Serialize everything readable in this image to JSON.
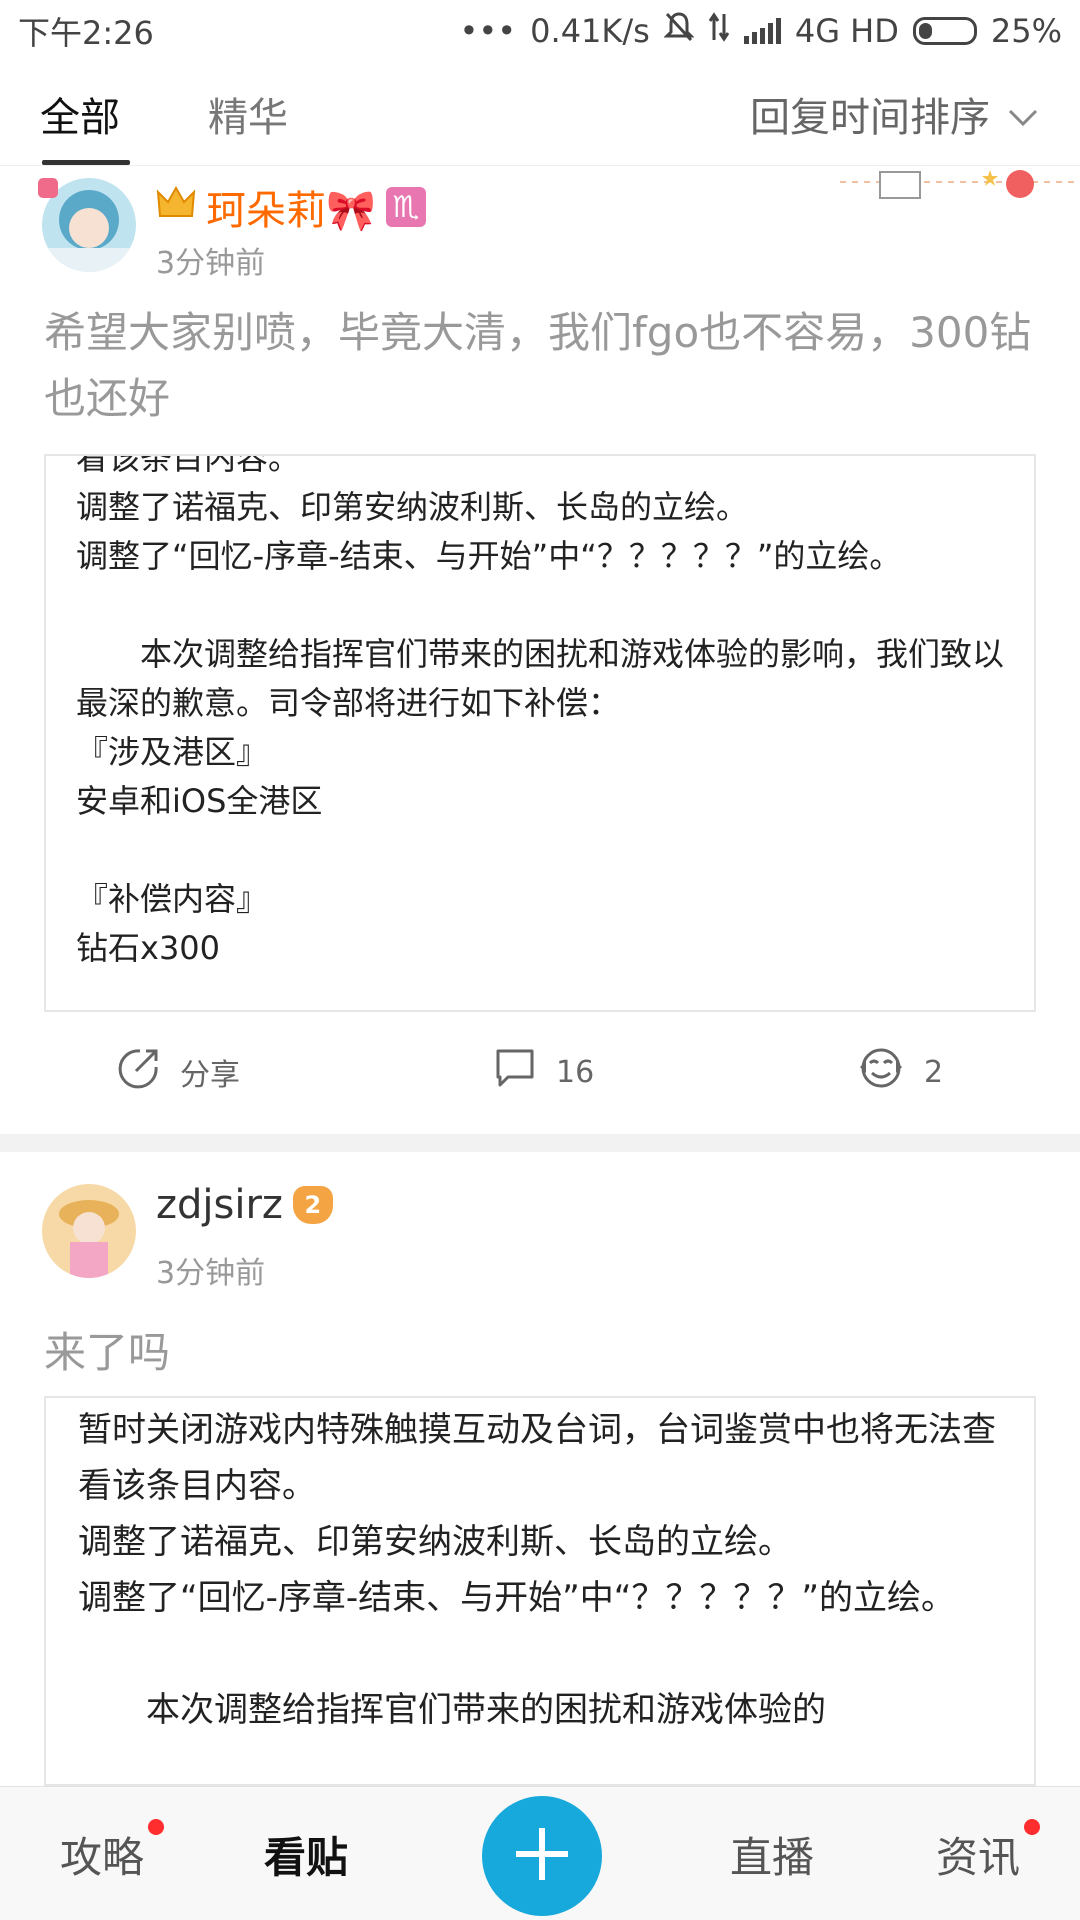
{
  "status_bar": {
    "time": "下午2:26",
    "network_speed": "0.41K/s",
    "network_type": "4G HD",
    "battery": "25%",
    "battery_level": 0.25
  },
  "tabs": {
    "all": "全部",
    "featured": "精华",
    "sort_label": "回复时间排序"
  },
  "posts": [
    {
      "user": "珂朵莉🎀",
      "zodiac": "♏",
      "time": "3分钟前",
      "text": "希望大家别喷，毕竟大清，我们fgo也不容易，300钻也还好",
      "quote": "看该条目内容。\n调整了诺福克、印第安纳波利斯、长岛的立绘。\n调整了“回忆-序章-结束、与开始”中“？？？？？”的立绘。\n\n　　本次调整给指挥官们带来的困扰和游戏体验的影响，我们致以最深的歉意。司令部将进行如下补偿：\n『涉及港区』\n安卓和iOS全港区\n\n『补偿内容』\n钻石x300",
      "share_label": "分享",
      "comment_count": "16",
      "like_count": "2"
    },
    {
      "user": "zdjsirz",
      "level_badge": "2",
      "time": "3分钟前",
      "text": "来了吗",
      "quote": "暂时关闭游戏内特殊触摸互动及台词，台词鉴赏中也将无法查看该条目内容。\n调整了诺福克、印第安纳波利斯、长岛的立绘。\n调整了“回忆-序章-结束、与开始”中“？？？？？”的立绘。\n\n　　本次调整给指挥官们带来的困扰和游戏体验的"
    }
  ],
  "bottom_nav": {
    "guide": "攻略",
    "posts": "看贴",
    "live": "直播",
    "news": "资讯"
  },
  "colors": {
    "accent": "#17a9dc",
    "username_orange": "#ff6a00",
    "notification_dot": "#ff2d2d"
  }
}
